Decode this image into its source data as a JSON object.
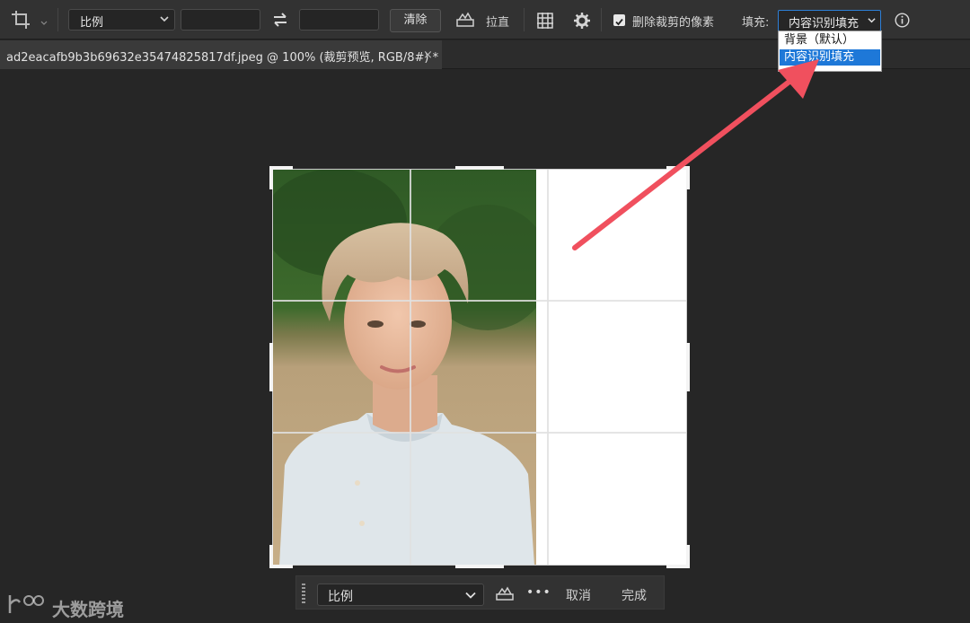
{
  "options_bar": {
    "ratio_select": "比例",
    "width_value": "",
    "height_value": "",
    "clear_button": "清除",
    "straighten_label": "拉直",
    "delete_cropped_label": "删除裁剪的像素",
    "delete_cropped_checked": true,
    "fill_label": "填充:",
    "fill_select": "内容识别填充"
  },
  "fill_dropdown": {
    "options": [
      "背景（默认）",
      "内容识别填充"
    ],
    "selected_index": 1
  },
  "document_tab": {
    "title": "ad2eacafb9b3b69632e35474825817df.jpeg @ 100% (裁剪预览, RGB/8#) *",
    "close": "×"
  },
  "bottom_bar": {
    "ratio_select": "比例",
    "more": "•••",
    "cancel": "取消",
    "done": "完成"
  },
  "watermark": {
    "text": "大数跨境"
  },
  "colors": {
    "accent": "#1e78d8",
    "arrow": "#f0505e",
    "panel": "#323232",
    "canvas": "#262626"
  }
}
